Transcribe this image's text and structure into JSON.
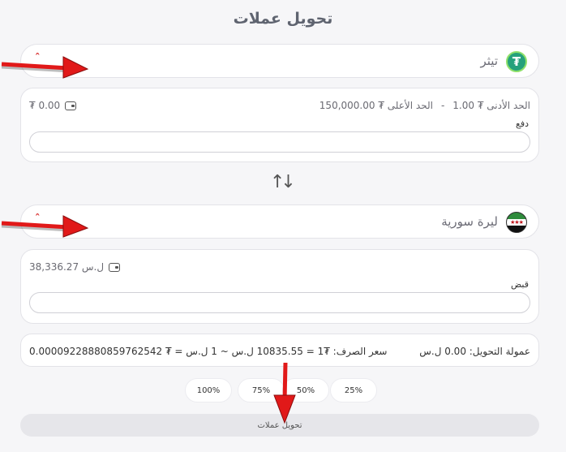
{
  "page": {
    "title": "تحويل عملات"
  },
  "from": {
    "currency_name": "تيثر",
    "balance": "₮ 0.00",
    "limits": {
      "min": "الحد الأدنى ₮ 1.00",
      "separator": "-",
      "max": "الحد الأعلى ₮ 150,000.00"
    },
    "field_label": "دفع",
    "input_value": ""
  },
  "to": {
    "currency_name": "ليرة سورية",
    "balance": "38,336.27 ل.س",
    "field_label": "قبض",
    "input_value": ""
  },
  "summary": {
    "commission": "عمولة التحويل: 0.00 ل.س",
    "rate": "سعر الصرف: ₮1 = 10835.55 ل.س ~ 1 ل.س = ₮ 0.00009228880859762542"
  },
  "percent_buttons": [
    "100%",
    "75%",
    "50%",
    "25%"
  ],
  "submit_label": "تحويل عملات",
  "colors": {
    "annotation_arrow": "#e11919",
    "tether_green": "#26a17b"
  },
  "icons": [
    "tether-logo-icon",
    "syria-flag-icon",
    "chevron-up-icon",
    "wallet-icon",
    "swap-arrows-icon"
  ]
}
